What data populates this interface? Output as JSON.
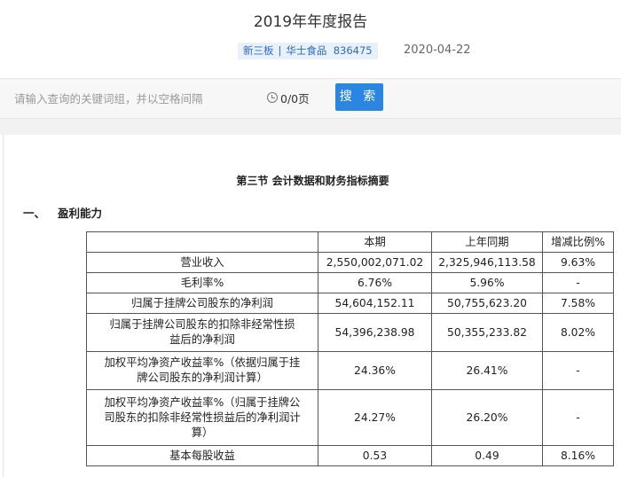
{
  "header": {
    "title": "2019年年度报告",
    "tag": {
      "board": "新三板",
      "separator": "|",
      "company": "华士食品",
      "code": "836475"
    },
    "date": "2020-04-22"
  },
  "toolbar": {
    "search_placeholder": "请输入查询的关键词组，并以空格间隔",
    "page_count": "0/0页",
    "search_label": "搜 索"
  },
  "document": {
    "section_title": "第三节 会计数据和财务指标摘要",
    "subsection_number": "一、",
    "subsection_title": "盈利能力",
    "table": {
      "headers": [
        "",
        "本期",
        "上年同期",
        "增减比例%"
      ],
      "rows": [
        [
          "营业收入",
          "2,550,002,071.02",
          "2,325,946,113.58",
          "9.63%"
        ],
        [
          "毛利率%",
          "6.76%",
          "5.96%",
          "-"
        ],
        [
          "归属于挂牌公司股东的净利润",
          "54,604,152.11",
          "50,755,623.20",
          "7.58%"
        ],
        [
          "归属于挂牌公司股东的扣除非经常性损益后的净利润",
          "54,396,238.98",
          "50,355,233.82",
          "8.02%"
        ],
        [
          "加权平均净资产收益率%（依据归属于挂牌公司股东的净利润计算）",
          "24.36%",
          "26.41%",
          "-"
        ],
        [
          "加权平均净资产收益率%（归属于挂牌公司股东的扣除非经常性损益后的净利润计算）",
          "24.27%",
          "26.20%",
          "-"
        ],
        [
          "基本每股收益",
          "0.53",
          "0.49",
          "8.16%"
        ]
      ]
    }
  }
}
